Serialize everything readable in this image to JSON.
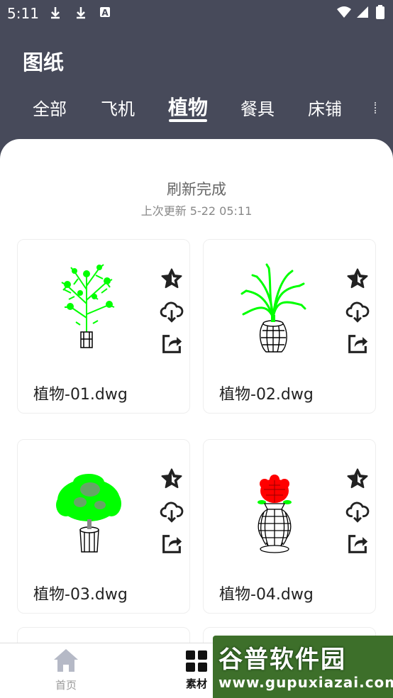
{
  "status_bar": {
    "time": "5:11",
    "left_icons": [
      "download-icon",
      "download-icon",
      "a-icon"
    ],
    "right_icons": [
      "wifi-icon",
      "signal-icon",
      "battery-icon"
    ]
  },
  "header": {
    "title": "图纸",
    "tabs": [
      {
        "label": "全部",
        "active": false
      },
      {
        "label": "飞机",
        "active": false
      },
      {
        "label": "植物",
        "active": true
      },
      {
        "label": "餐具",
        "active": false
      },
      {
        "label": "床铺",
        "active": false
      }
    ]
  },
  "refresh": {
    "status": "刷新完成",
    "last_update": "上次更新 5-22 05:11"
  },
  "cards": [
    {
      "name": "植物-01.dwg",
      "icons": [
        "star-icon",
        "cloud-download-icon",
        "share-icon"
      ]
    },
    {
      "name": "植物-02.dwg",
      "icons": [
        "star-icon",
        "cloud-download-icon",
        "share-icon"
      ]
    },
    {
      "name": "植物-03.dwg",
      "icons": [
        "star-icon",
        "cloud-download-icon",
        "share-icon"
      ]
    },
    {
      "name": "植物-04.dwg",
      "icons": [
        "star-icon",
        "cloud-download-icon",
        "share-icon"
      ]
    }
  ],
  "bottom_nav": [
    {
      "label": "首页",
      "icon": "home-icon",
      "active": false
    },
    {
      "label": "素材",
      "icon": "grid-icon",
      "active": true
    }
  ],
  "watermark": {
    "title": "谷普软件园",
    "url": "www.gupuxiazai.com"
  },
  "colors": {
    "header_bg": "#474a5a",
    "plant_green": "#00ff00",
    "flower_red": "#ff0000"
  }
}
